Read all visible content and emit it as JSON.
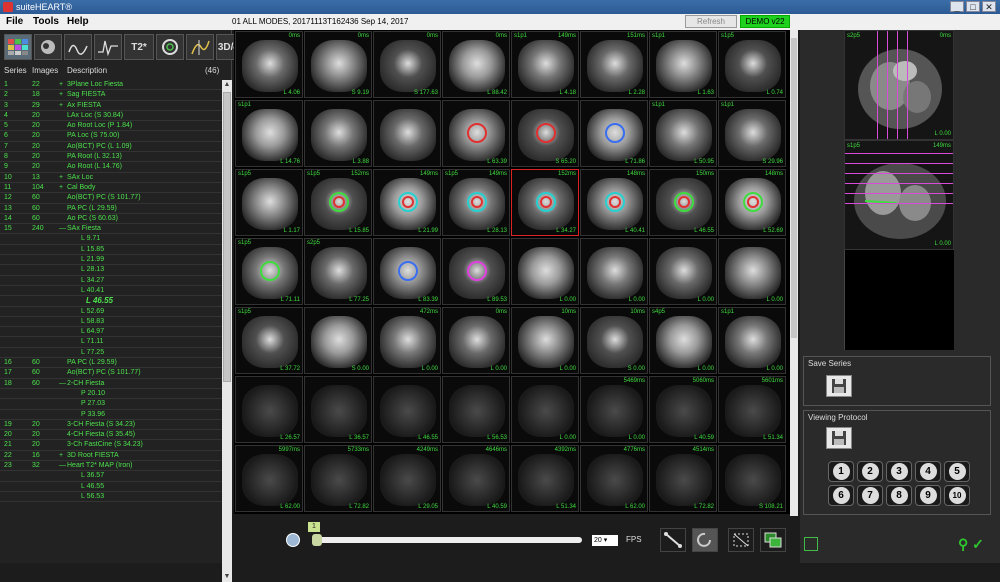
{
  "window": {
    "title": "suiteHEART®",
    "controls": [
      "_",
      "□",
      "✕"
    ]
  },
  "menu": {
    "file": "File",
    "tools": "Tools",
    "help": "Help"
  },
  "study": {
    "info": "01 ALL MODES, 20171113T162436   Sep 14, 2017"
  },
  "header_buttons": {
    "refresh": "Refresh",
    "demo": "DEMO v22"
  },
  "tools": {
    "t2": "T2*",
    "mode3d": "3D/4D"
  },
  "series_list": {
    "headers": {
      "series": "Series",
      "images": "Images",
      "description": "Description",
      "count": "(46)"
    },
    "rows": [
      {
        "series": "1",
        "images": "22",
        "desc": "3Plane Loc Fiesta",
        "expand": "+"
      },
      {
        "series": "2",
        "images": "18",
        "desc": "Sag FIESTA",
        "expand": "+"
      },
      {
        "series": "3",
        "images": "29",
        "desc": "Ax FIESTA",
        "expand": "+"
      },
      {
        "series": "4",
        "images": "20",
        "desc": "LAx Loc (S 30.84)",
        "expand": ""
      },
      {
        "series": "5",
        "images": "20",
        "desc": "Ao Root Loc (P 1.84)",
        "expand": ""
      },
      {
        "series": "6",
        "images": "20",
        "desc": "PA  Loc (S 75.00)",
        "expand": ""
      },
      {
        "series": "7",
        "images": "20",
        "desc": "Ao(BCT) PC (L 1.09)",
        "expand": ""
      },
      {
        "series": "8",
        "images": "20",
        "desc": "PA Root (L 32.13)",
        "expand": ""
      },
      {
        "series": "9",
        "images": "20",
        "desc": "Ao Root (L 14.76)",
        "expand": ""
      },
      {
        "series": "10",
        "images": "13",
        "desc": "SAx Loc",
        "expand": "+"
      },
      {
        "series": "11",
        "images": "104",
        "desc": "Cal Body",
        "expand": "+"
      },
      {
        "series": "12",
        "images": "60",
        "desc": "Ao(BCT) PC (S 101.77)",
        "expand": ""
      },
      {
        "series": "13",
        "images": "60",
        "desc": "PA PC (L 29.59)",
        "expand": ""
      },
      {
        "series": "14",
        "images": "60",
        "desc": "Ao PC (S 60.63)",
        "expand": ""
      },
      {
        "series": "15",
        "images": "240",
        "desc": "SAx Fiesta",
        "expand": "—"
      },
      {
        "series": "",
        "images": "",
        "desc": "L 9.71",
        "sub": true
      },
      {
        "series": "",
        "images": "",
        "desc": "L 15.85",
        "sub": true
      },
      {
        "series": "",
        "images": "",
        "desc": "L 21.99",
        "sub": true
      },
      {
        "series": "",
        "images": "",
        "desc": "L 28.13",
        "sub": true
      },
      {
        "series": "",
        "images": "",
        "desc": "L 34.27",
        "sub": true
      },
      {
        "series": "",
        "images": "",
        "desc": "L 40.41",
        "sub": true
      },
      {
        "series": "",
        "images": "",
        "desc": "L 46.55",
        "selected": true
      },
      {
        "series": "",
        "images": "",
        "desc": "L 52.69",
        "sub": true
      },
      {
        "series": "",
        "images": "",
        "desc": "L 58.83",
        "sub": true
      },
      {
        "series": "",
        "images": "",
        "desc": "L 64.97",
        "sub": true
      },
      {
        "series": "",
        "images": "",
        "desc": "L 71.11",
        "sub": true
      },
      {
        "series": "",
        "images": "",
        "desc": "L 77.25",
        "sub": true
      },
      {
        "series": "16",
        "images": "60",
        "desc": "PA PC (L 29.59)",
        "expand": ""
      },
      {
        "series": "17",
        "images": "60",
        "desc": "Ao(BCT) PC (S 101.77)",
        "expand": ""
      },
      {
        "series": "18",
        "images": "60",
        "desc": "2-CH Fiesta",
        "expand": "—"
      },
      {
        "series": "",
        "images": "",
        "desc": "P 20.10",
        "sub": true
      },
      {
        "series": "",
        "images": "",
        "desc": "P 27.03",
        "sub": true
      },
      {
        "series": "",
        "images": "",
        "desc": "P 33.96",
        "sub": true
      },
      {
        "series": "19",
        "images": "20",
        "desc": "3-CH Fiesta (S 34.23)",
        "expand": ""
      },
      {
        "series": "20",
        "images": "20",
        "desc": "4-CH Fiesta (S 35.45)",
        "expand": ""
      },
      {
        "series": "21",
        "images": "20",
        "desc": "3-Ch FastCine (S 34.23)",
        "expand": ""
      },
      {
        "series": "22",
        "images": "16",
        "desc": "3D Root FIESTA",
        "expand": "+"
      },
      {
        "series": "23",
        "images": "32",
        "desc": "Heart T2* MAP (Iron)",
        "expand": "—"
      },
      {
        "series": "",
        "images": "",
        "desc": "L 36.57",
        "sub": true
      },
      {
        "series": "",
        "images": "",
        "desc": "L 46.55",
        "sub": true
      },
      {
        "series": "",
        "images": "",
        "desc": "L 56.53",
        "sub": true
      }
    ]
  },
  "grid": {
    "cells": [
      [
        {
          "tl": "",
          "tr": "0ms",
          "br": "L 4.06"
        },
        {
          "tl": "",
          "tr": "0ms",
          "br": "S 9.19"
        },
        {
          "tl": "",
          "tr": "0ms",
          "br": "S 177.63"
        },
        {
          "tl": "",
          "tr": "0ms",
          "br": "L 88.42"
        },
        {
          "tl": "s1p1",
          "tr": "149ms",
          "br": "L 4.18"
        },
        {
          "tl": "",
          "tr": "151ms",
          "br": "L 2.28"
        },
        {
          "tl": "s1p1",
          "tr": "",
          "br": "L 1.63"
        },
        {
          "tl": "s1p5",
          "tr": "",
          "br": "L 0.74"
        }
      ],
      [
        {
          "tl": "s1p1",
          "tr": "",
          "br": "L 14.76"
        },
        {
          "tl": "",
          "tr": "",
          "br": "L 3.88"
        },
        {
          "tl": "",
          "tr": "",
          "br": ""
        },
        {
          "tl": "",
          "tr": "",
          "br": "L 63.39"
        },
        {
          "tl": "",
          "tr": "",
          "br": "S 65.20"
        },
        {
          "tl": "",
          "tr": "",
          "br": "L 71.86"
        },
        {
          "tl": "s1p1",
          "tr": "",
          "br": "L 50.95"
        },
        {
          "tl": "s1p1",
          "tr": "",
          "br": "S 29.96"
        }
      ],
      [
        {
          "tl": "s1p5",
          "tr": "",
          "br": "L 1.17"
        },
        {
          "tl": "s1p5",
          "tr": "152ms",
          "br": "L 15.85"
        },
        {
          "tl": "",
          "tr": "149ms",
          "br": "L 21.99"
        },
        {
          "tl": "s1p5",
          "tr": "149ms",
          "br": "L 28.13"
        },
        {
          "tl": "",
          "tr": "152ms",
          "br": "L 34.27"
        },
        {
          "tl": "",
          "tr": "148ms",
          "br": "L 40.41"
        },
        {
          "tl": "",
          "tr": "150ms",
          "br": "L 46.55"
        },
        {
          "tl": "",
          "tr": "148ms",
          "br": "L 52.69"
        }
      ],
      [
        {
          "tl": "s1p5",
          "tr": "",
          "br": "L 71.11"
        },
        {
          "tl": "s2p5",
          "tr": "",
          "br": "L 77.25"
        },
        {
          "tl": "",
          "tr": "",
          "br": "L 83.39"
        },
        {
          "tl": "",
          "tr": "",
          "br": "L 89.53"
        },
        {
          "tl": "",
          "tr": "",
          "br": "L 0.00"
        },
        {
          "tl": "",
          "tr": "",
          "br": "L 0.00"
        },
        {
          "tl": "",
          "tr": "",
          "br": "L 0.00"
        },
        {
          "tl": "",
          "tr": "",
          "br": "L 0.00"
        }
      ],
      [
        {
          "tl": "s1p5",
          "tr": "",
          "br": "L 37.72"
        },
        {
          "tl": "",
          "tr": "",
          "br": "S 0.00"
        },
        {
          "tl": "",
          "tr": "472ms",
          "br": "L 0.00"
        },
        {
          "tl": "",
          "tr": "0ms",
          "br": "L 0.00"
        },
        {
          "tl": "",
          "tr": "10ms",
          "br": "L 0.00"
        },
        {
          "tl": "",
          "tr": "10ms",
          "br": "S 0.00"
        },
        {
          "tl": "s4p5",
          "tr": "",
          "br": "L 0.00"
        },
        {
          "tl": "s1p1",
          "tr": "",
          "br": "L 0.00"
        }
      ],
      [
        {
          "tl": "",
          "tr": "",
          "br": "L 26.57"
        },
        {
          "tl": "",
          "tr": "",
          "br": "L 36.57"
        },
        {
          "tl": "",
          "tr": "",
          "br": "L 46.55"
        },
        {
          "tl": "",
          "tr": "",
          "br": "L 56.53"
        },
        {
          "tl": "",
          "tr": "",
          "br": "L 0.00"
        },
        {
          "tl": "",
          "tr": "5469ms",
          "br": "L 0.00"
        },
        {
          "tl": "",
          "tr": "5060ms",
          "br": "L 40.59"
        },
        {
          "tl": "",
          "tr": "5601ms",
          "br": "L 51.34"
        }
      ],
      [
        {
          "tl": "",
          "tr": "5997ms",
          "br": "L 62.00"
        },
        {
          "tl": "",
          "tr": "5733ms",
          "br": "L 72.82"
        },
        {
          "tl": "",
          "tr": "4249ms",
          "br": "L 29.05"
        },
        {
          "tl": "",
          "tr": "4646ms",
          "br": "L 40.59"
        },
        {
          "tl": "",
          "tr": "4392ms",
          "br": "L 51.34"
        },
        {
          "tl": "",
          "tr": "4776ms",
          "br": "L 62.00"
        },
        {
          "tl": "",
          "tr": "4514ms",
          "br": "L 72.82"
        },
        {
          "tl": "",
          "tr": "",
          "br": "S 108.21"
        }
      ]
    ]
  },
  "right_thumbs": [
    {
      "tl": "s2p5",
      "tr": "0ms",
      "br": "L 0.00"
    },
    {
      "tl": "s1p5",
      "tr": "149ms",
      "br": "L 0.00"
    }
  ],
  "save_series": {
    "label": "Save Series"
  },
  "viewing_protocol": {
    "label": "Viewing Protocol",
    "numbers": [
      "1",
      "2",
      "3",
      "4",
      "5",
      "6",
      "7",
      "8",
      "9",
      "10"
    ]
  },
  "playback": {
    "frame": "1",
    "fps_value": "20",
    "fps_label": "FPS",
    "progress": 0
  }
}
